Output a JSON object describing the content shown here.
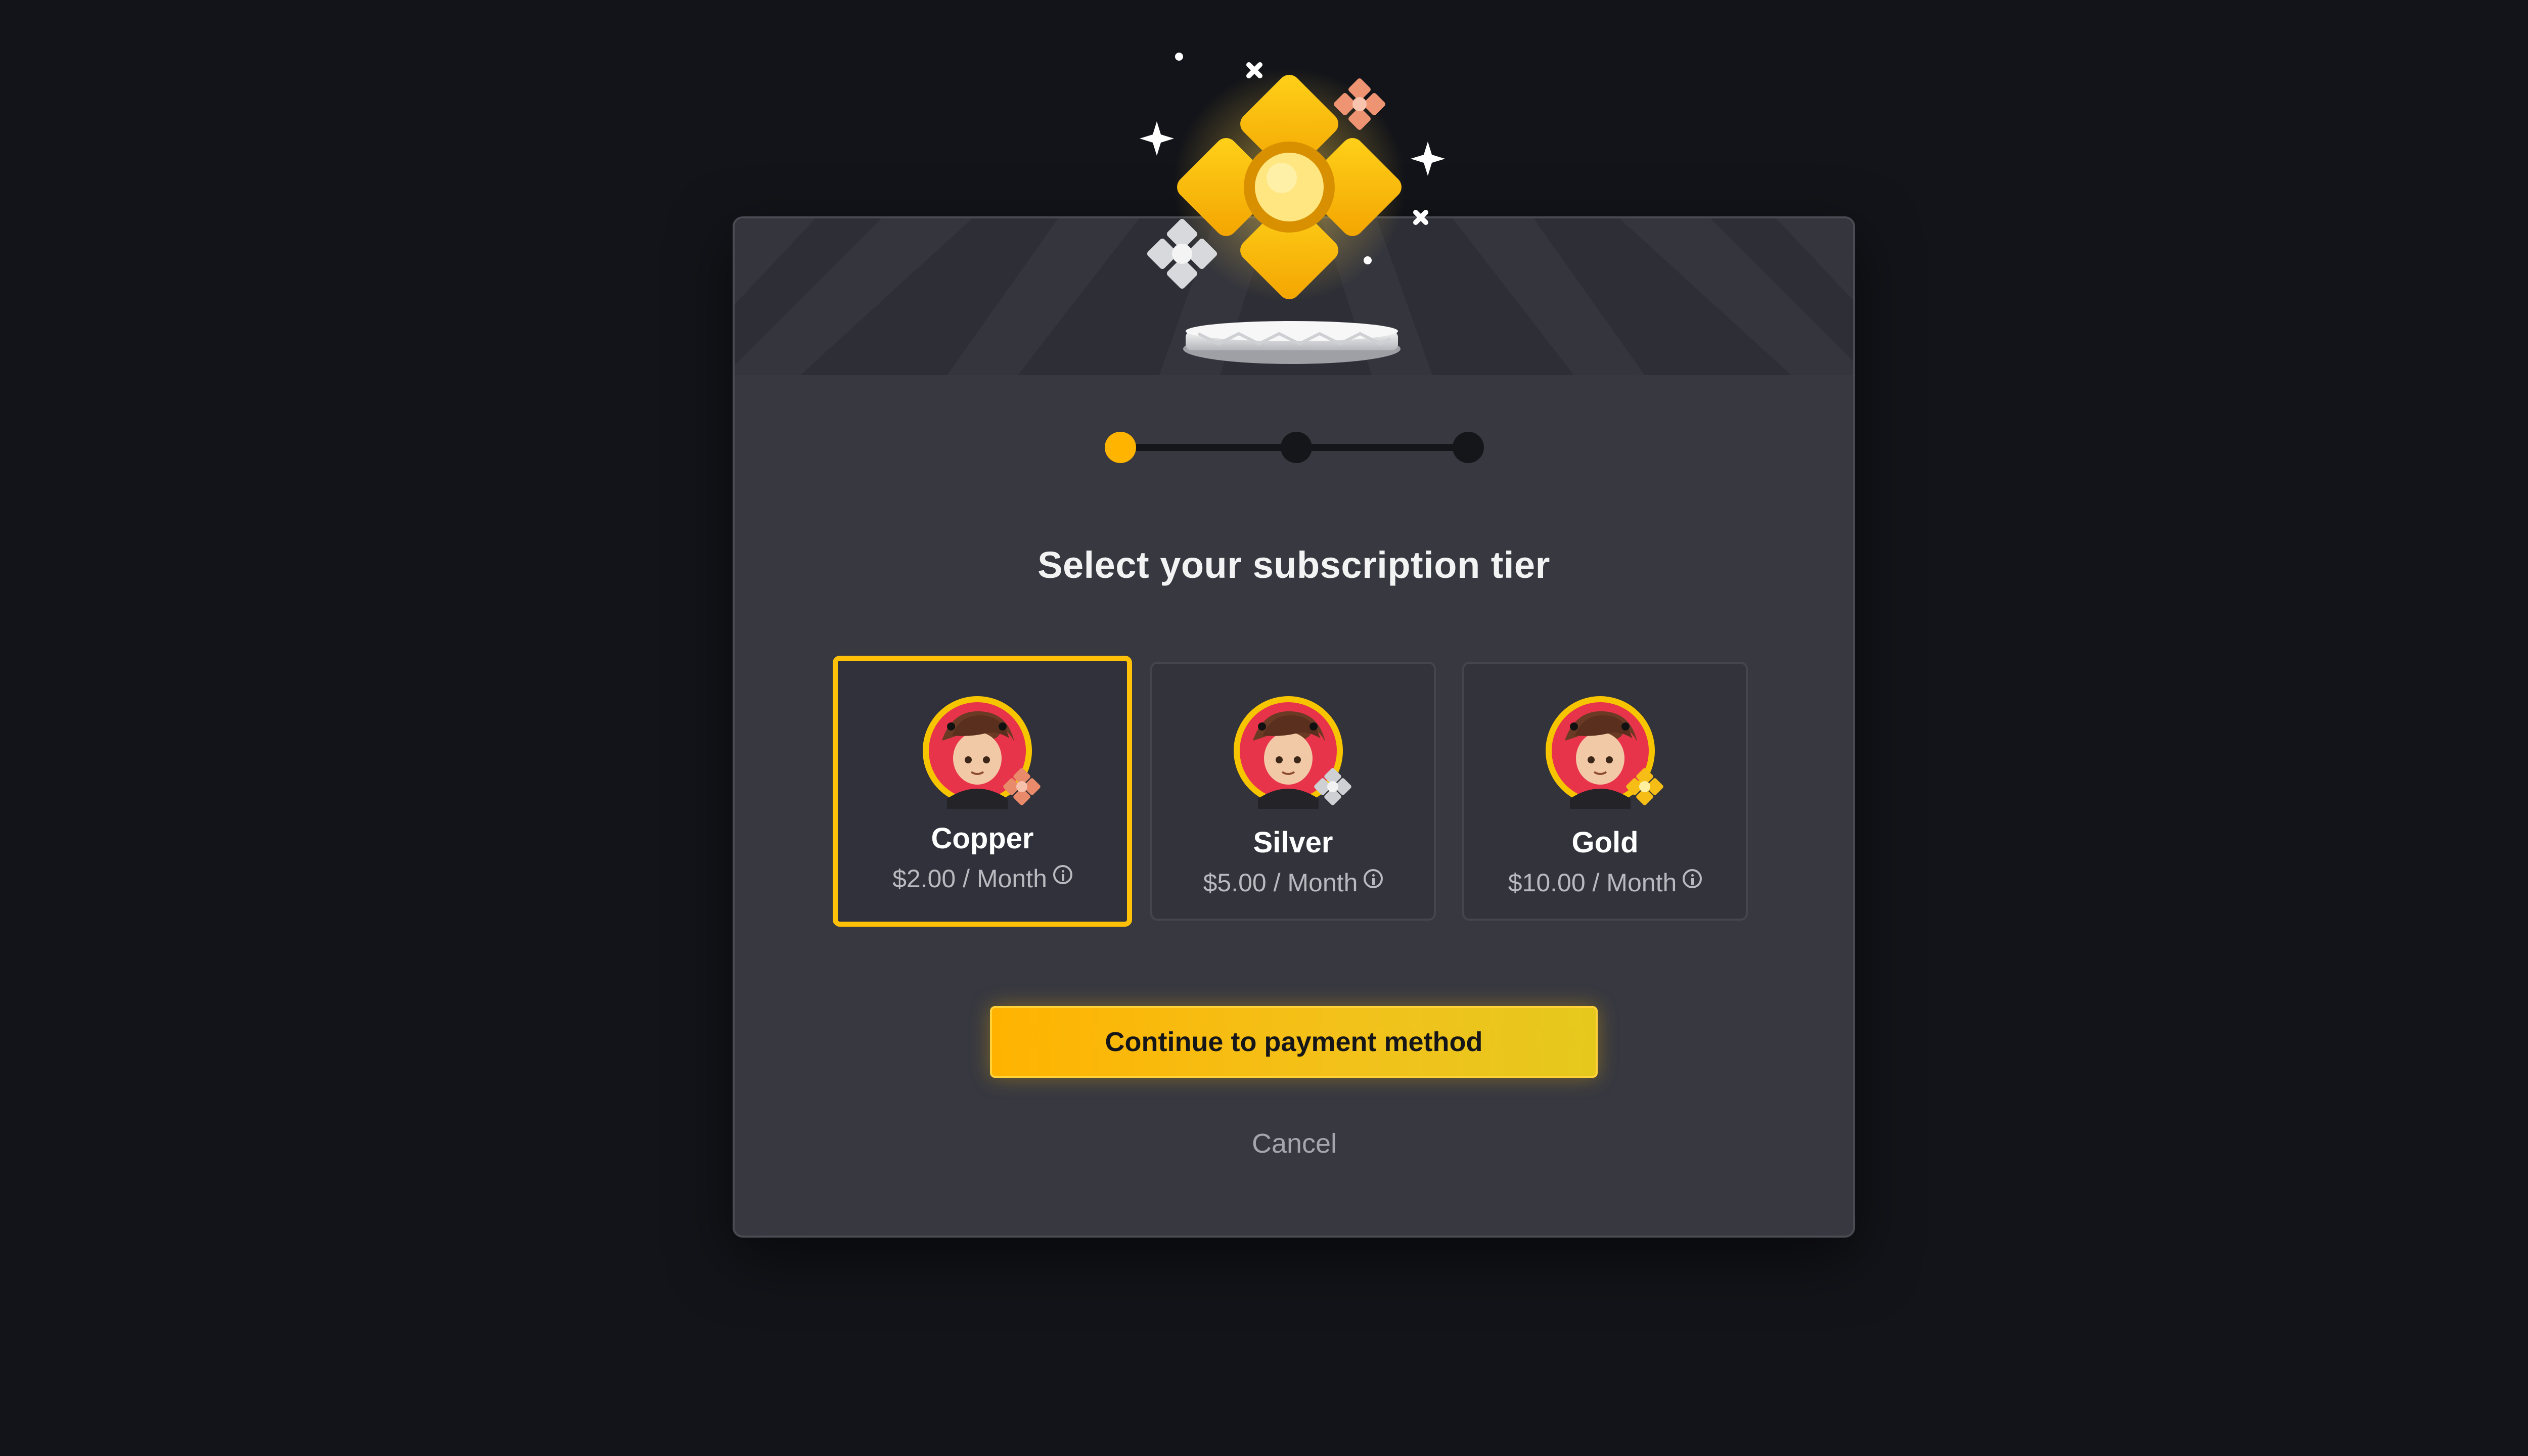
{
  "dialog": {
    "title": "Select your subscription tier",
    "stepper": {
      "total_steps": 3,
      "current_step": 1
    },
    "tiers": [
      {
        "name": "Copper",
        "price": "$2.00 / Month",
        "selected": true,
        "badge_color": "#e98a6a",
        "info_icon": "info-circle-icon"
      },
      {
        "name": "Silver",
        "price": "$5.00 / Month",
        "selected": false,
        "badge_color": "#cfd0d4",
        "info_icon": "info-circle-icon"
      },
      {
        "name": "Gold",
        "price": "$10.00 / Month",
        "selected": false,
        "badge_color": "#f6bd16",
        "info_icon": "info-circle-icon"
      }
    ],
    "continue_label": "Continue to payment method",
    "cancel_label": "Cancel"
  },
  "colors": {
    "background": "#131419",
    "dialog": "#373840",
    "accent": "#ffc107",
    "text": "#f3f3f4",
    "muted_text": "#b9bac0"
  }
}
